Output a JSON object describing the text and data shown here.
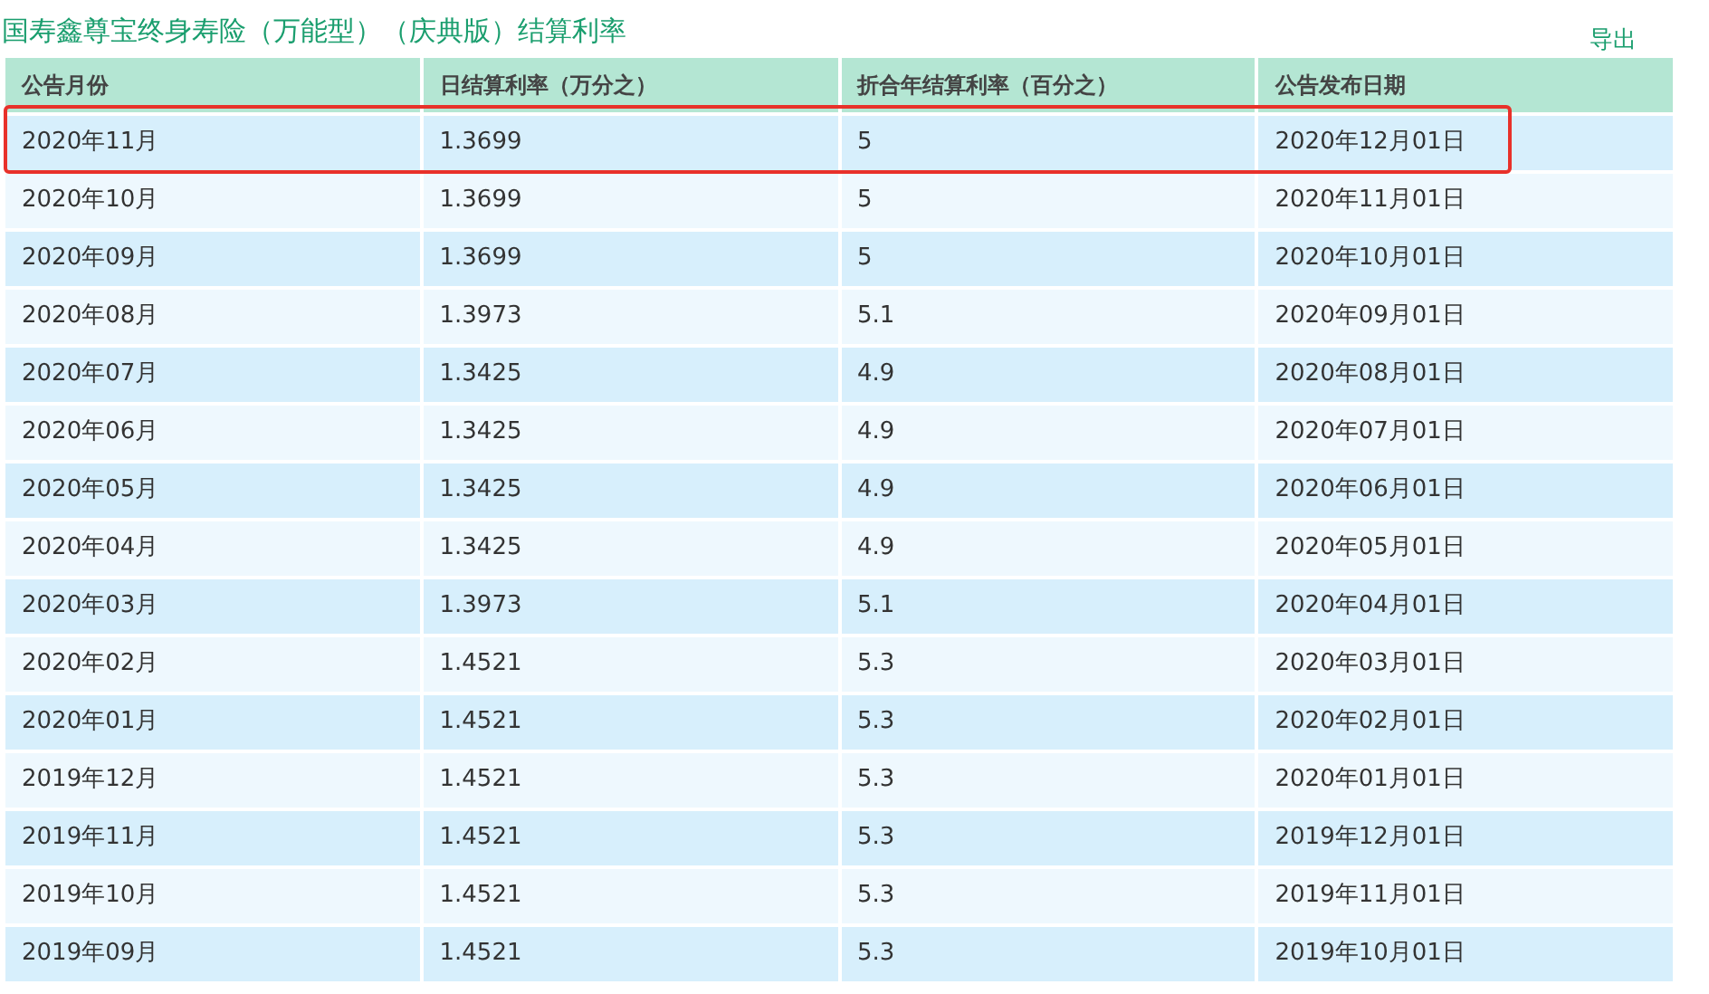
{
  "title": "国寿鑫尊宝终身寿险（万能型）（庆典版）结算利率",
  "export_link": "导出",
  "table": {
    "columns": [
      "公告月份",
      "日结算利率（万分之）",
      "折合年结算利率（百分之）",
      "公告发布日期"
    ],
    "rows": [
      {
        "cells": [
          "2020年11月",
          "1.3699",
          "5",
          "2020年12月01日"
        ],
        "highlighted": true
      },
      {
        "cells": [
          "2020年10月",
          "1.3699",
          "5",
          "2020年11月01日"
        ],
        "highlighted": false
      },
      {
        "cells": [
          "2020年09月",
          "1.3699",
          "5",
          "2020年10月01日"
        ],
        "highlighted": false
      },
      {
        "cells": [
          "2020年08月",
          "1.3973",
          "5.1",
          "2020年09月01日"
        ],
        "highlighted": false
      },
      {
        "cells": [
          "2020年07月",
          "1.3425",
          "4.9",
          "2020年08月01日"
        ],
        "highlighted": false
      },
      {
        "cells": [
          "2020年06月",
          "1.3425",
          "4.9",
          "2020年07月01日"
        ],
        "highlighted": false
      },
      {
        "cells": [
          "2020年05月",
          "1.3425",
          "4.9",
          "2020年06月01日"
        ],
        "highlighted": false
      },
      {
        "cells": [
          "2020年04月",
          "1.3425",
          "4.9",
          "2020年05月01日"
        ],
        "highlighted": false
      },
      {
        "cells": [
          "2020年03月",
          "1.3973",
          "5.1",
          "2020年04月01日"
        ],
        "highlighted": false
      },
      {
        "cells": [
          "2020年02月",
          "1.4521",
          "5.3",
          "2020年03月01日"
        ],
        "highlighted": false
      },
      {
        "cells": [
          "2020年01月",
          "1.4521",
          "5.3",
          "2020年02月01日"
        ],
        "highlighted": false
      },
      {
        "cells": [
          "2019年12月",
          "1.4521",
          "5.3",
          "2020年01月01日"
        ],
        "highlighted": false
      },
      {
        "cells": [
          "2019年11月",
          "1.4521",
          "5.3",
          "2019年12月01日"
        ],
        "highlighted": false
      },
      {
        "cells": [
          "2019年10月",
          "1.4521",
          "5.3",
          "2019年11月01日"
        ],
        "highlighted": false
      },
      {
        "cells": [
          "2019年09月",
          "1.4521",
          "5.3",
          "2019年10月01日"
        ],
        "highlighted": false
      }
    ]
  }
}
